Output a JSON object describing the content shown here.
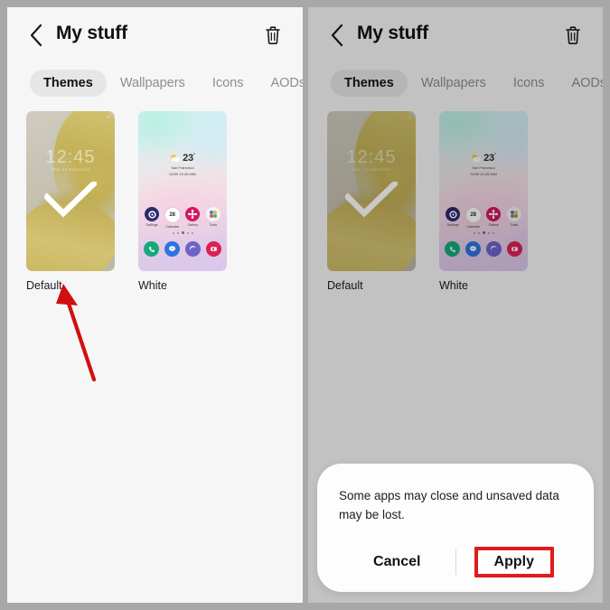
{
  "panels": [
    {
      "id": "left",
      "dimmed": false,
      "header": {
        "back_icon": "chevron-left-icon",
        "title": "My stuff",
        "delete_icon": "trash-icon"
      },
      "tabs": [
        {
          "label": "Themes",
          "active": true
        },
        {
          "label": "Wallpapers",
          "active": false
        },
        {
          "label": "Icons",
          "active": false
        },
        {
          "label": "AODs",
          "active": false
        }
      ],
      "items": [
        {
          "label": "Default",
          "selected": true,
          "type": "lockscreen"
        },
        {
          "label": "White",
          "selected": false,
          "type": "homescreen"
        }
      ],
      "annotation": {
        "type": "arrow",
        "color": "#d01010",
        "points_to": "Default"
      },
      "dialog": null
    },
    {
      "id": "right",
      "dimmed": true,
      "header": {
        "back_icon": "chevron-left-icon",
        "title": "My stuff",
        "delete_icon": "trash-icon"
      },
      "tabs": [
        {
          "label": "Themes",
          "active": true
        },
        {
          "label": "Wallpapers",
          "active": false
        },
        {
          "label": "Icons",
          "active": false
        },
        {
          "label": "AODs",
          "active": false
        }
      ],
      "items": [
        {
          "label": "Default",
          "selected": true,
          "type": "lockscreen"
        },
        {
          "label": "White",
          "selected": false,
          "type": "homescreen"
        }
      ],
      "annotation": null,
      "dialog": {
        "message": "Some apps may close and unsaved data may be lost.",
        "cancel_label": "Cancel",
        "apply_label": "Apply",
        "highlighted_button": "Apply",
        "highlight_color": "#e01b1b"
      }
    }
  ],
  "lockscreen_preview": {
    "clock": "12:45",
    "subtitle": "Wed, 13 September",
    "battery": "78",
    "checkmark": true
  },
  "homescreen_preview": {
    "weather": {
      "temperature": "23",
      "degree": "°",
      "city": "San Francisco",
      "description": "24/09 13:45 Mild"
    },
    "apps": [
      {
        "name": "Settings",
        "color": "#2a2a6e"
      },
      {
        "name": "Calendar",
        "color": "#ffffff",
        "day": "28"
      },
      {
        "name": "Gallery",
        "color": "#d3165f"
      },
      {
        "name": "Tools",
        "color": "#f2f2f2"
      }
    ],
    "page_dots": 5,
    "active_dot": 2,
    "dock": [
      {
        "name": "phone-icon",
        "color": "#16a97a"
      },
      {
        "name": "messages-icon",
        "color": "#2f73dd"
      },
      {
        "name": "internet-icon",
        "color": "#6e62c8"
      },
      {
        "name": "camera-icon",
        "color": "#dd2055"
      }
    ]
  },
  "theme": {
    "frame_color": "#a8a8a8",
    "panel_bg": "#f6f6f6",
    "tab_active_bg": "#e6e6e6",
    "text_primary": "#121212",
    "text_muted": "#8d8d8d"
  }
}
